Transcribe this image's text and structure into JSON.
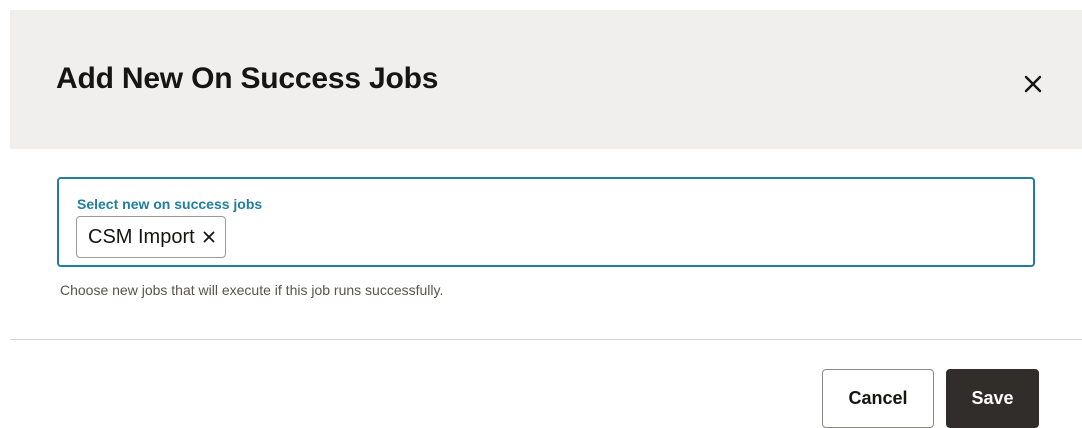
{
  "dialog": {
    "title": "Add New On Success Jobs",
    "close_icon": "close-icon"
  },
  "field": {
    "label": "Select new on success jobs",
    "selected_chips": [
      {
        "label": "CSM Import",
        "remove_icon": "close-icon"
      }
    ],
    "help_text": "Choose new jobs that will execute if this job runs successfully."
  },
  "footer": {
    "cancel_label": "Cancel",
    "save_label": "Save"
  },
  "colors": {
    "header_background": "#f1efed",
    "focus_accent": "#227e9e",
    "primary_button": "#312d2a",
    "text": "#161513"
  }
}
